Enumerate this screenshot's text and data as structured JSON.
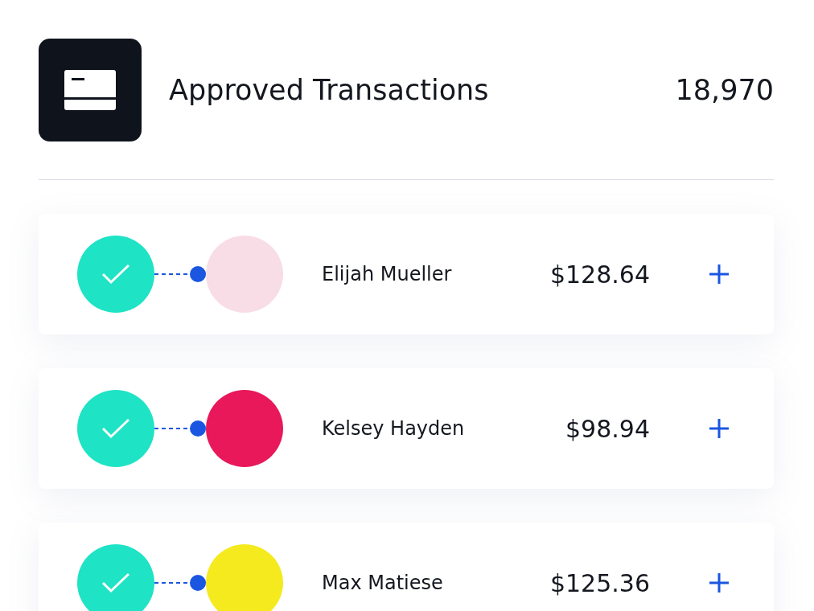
{
  "header": {
    "title": "Approved Transactions",
    "count": "18,970"
  },
  "transactions": [
    {
      "name": "Elijah Mueller",
      "amount": "$128.64",
      "approved": true,
      "color": "#f8dde6"
    },
    {
      "name": "Kelsey Hayden",
      "amount": "$98.94",
      "approved": true,
      "color": "#e8185a"
    },
    {
      "name": "Max Matiese",
      "amount": "$125.36",
      "approved": true,
      "color": "#f4ea1e"
    }
  ]
}
